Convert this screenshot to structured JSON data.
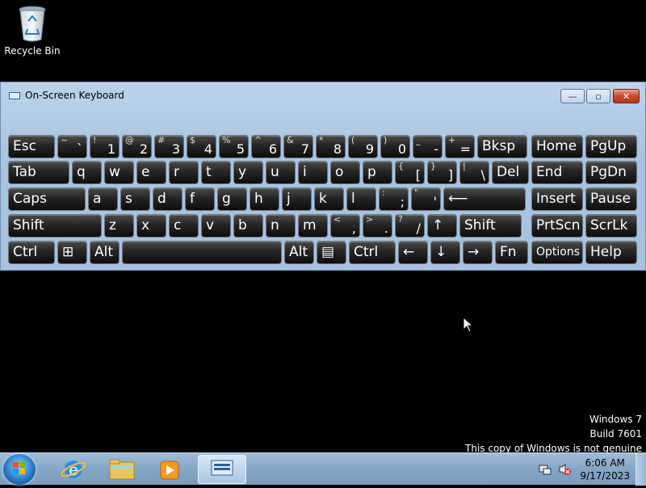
{
  "desktop": {
    "recycle_bin_label": "Recycle Bin"
  },
  "osk": {
    "title": "On-Screen Keyboard",
    "buttons": {
      "minimize": "minimize",
      "maximize": "maximize",
      "close": "close"
    },
    "rows": [
      [
        {
          "id": "esc",
          "main": "Esc"
        },
        {
          "id": "tilde",
          "hi": "~",
          "lo": "`"
        },
        {
          "id": "1",
          "hi": "!",
          "lo": "1"
        },
        {
          "id": "2",
          "hi": "@",
          "lo": "2"
        },
        {
          "id": "3",
          "hi": "#",
          "lo": "3"
        },
        {
          "id": "4",
          "hi": "$",
          "lo": "4"
        },
        {
          "id": "5",
          "hi": "%",
          "lo": "5"
        },
        {
          "id": "6",
          "hi": "^",
          "lo": "6"
        },
        {
          "id": "7",
          "hi": "&",
          "lo": "7"
        },
        {
          "id": "8",
          "hi": "*",
          "lo": "8"
        },
        {
          "id": "9",
          "hi": "(",
          "lo": "9"
        },
        {
          "id": "0",
          "hi": ")",
          "lo": "0"
        },
        {
          "id": "minus",
          "hi": "_",
          "lo": "-"
        },
        {
          "id": "equals",
          "hi": "+",
          "lo": "="
        },
        {
          "id": "bksp",
          "main": "Bksp"
        },
        {
          "id": "home",
          "main": "Home"
        },
        {
          "id": "pgup",
          "main": "PgUp"
        }
      ],
      [
        {
          "id": "tab",
          "main": "Tab"
        },
        {
          "id": "q",
          "main": "q"
        },
        {
          "id": "w",
          "main": "w"
        },
        {
          "id": "e",
          "main": "e"
        },
        {
          "id": "r",
          "main": "r"
        },
        {
          "id": "t",
          "main": "t"
        },
        {
          "id": "y",
          "main": "y"
        },
        {
          "id": "u",
          "main": "u"
        },
        {
          "id": "i",
          "main": "i"
        },
        {
          "id": "o",
          "main": "o"
        },
        {
          "id": "p",
          "main": "p"
        },
        {
          "id": "lbracket",
          "hi": "{",
          "lo": "["
        },
        {
          "id": "rbracket",
          "hi": "}",
          "lo": "]"
        },
        {
          "id": "backslash",
          "hi": "|",
          "lo": "\\"
        },
        {
          "id": "del",
          "main": "Del"
        },
        {
          "id": "end",
          "main": "End"
        },
        {
          "id": "pgdn",
          "main": "PgDn"
        }
      ],
      [
        {
          "id": "caps",
          "main": "Caps"
        },
        {
          "id": "a",
          "main": "a"
        },
        {
          "id": "s",
          "main": "s"
        },
        {
          "id": "d",
          "main": "d"
        },
        {
          "id": "f",
          "main": "f"
        },
        {
          "id": "g",
          "main": "g"
        },
        {
          "id": "h",
          "main": "h"
        },
        {
          "id": "j",
          "main": "j"
        },
        {
          "id": "k",
          "main": "k"
        },
        {
          "id": "l",
          "main": "l"
        },
        {
          "id": "semicolon",
          "hi": ":",
          "lo": ";"
        },
        {
          "id": "quote",
          "hi": "\"",
          "lo": "'"
        },
        {
          "id": "enter",
          "main": "⟵"
        },
        {
          "id": "insert",
          "main": "Insert"
        },
        {
          "id": "pause",
          "main": "Pause"
        }
      ],
      [
        {
          "id": "lshift",
          "main": "Shift"
        },
        {
          "id": "z",
          "main": "z"
        },
        {
          "id": "x",
          "main": "x"
        },
        {
          "id": "c",
          "main": "c"
        },
        {
          "id": "v",
          "main": "v"
        },
        {
          "id": "b",
          "main": "b"
        },
        {
          "id": "n",
          "main": "n"
        },
        {
          "id": "m",
          "main": "m"
        },
        {
          "id": "comma",
          "hi": "<",
          "lo": ","
        },
        {
          "id": "period",
          "hi": ">",
          "lo": "."
        },
        {
          "id": "slash",
          "hi": "?",
          "lo": "/"
        },
        {
          "id": "uparrow",
          "main": "↑"
        },
        {
          "id": "rshift",
          "main": "Shift"
        },
        {
          "id": "prtscn",
          "main": "PrtScn"
        },
        {
          "id": "scrlk",
          "main": "ScrLk"
        }
      ],
      [
        {
          "id": "lctrl",
          "main": "Ctrl"
        },
        {
          "id": "win",
          "main": "⊞"
        },
        {
          "id": "lalt",
          "main": "Alt"
        },
        {
          "id": "space",
          "main": ""
        },
        {
          "id": "ralt",
          "main": "Alt"
        },
        {
          "id": "menu",
          "main": "▤"
        },
        {
          "id": "rctrl",
          "main": "Ctrl"
        },
        {
          "id": "leftarrow",
          "main": "←"
        },
        {
          "id": "downarrow",
          "main": "↓"
        },
        {
          "id": "rightarrow",
          "main": "→"
        },
        {
          "id": "fn",
          "main": "Fn"
        },
        {
          "id": "options",
          "main": "Options"
        },
        {
          "id": "help",
          "main": "Help"
        }
      ]
    ]
  },
  "watermark": {
    "line1": "Windows 7",
    "line2": "Build 7601",
    "line3": "This copy of Windows is not genuine"
  },
  "taskbar": {
    "items": [
      "internet-explorer",
      "windows-explorer",
      "media-player",
      "on-screen-keyboard"
    ],
    "time": "6:06 AM",
    "date": "9/17/2023"
  }
}
